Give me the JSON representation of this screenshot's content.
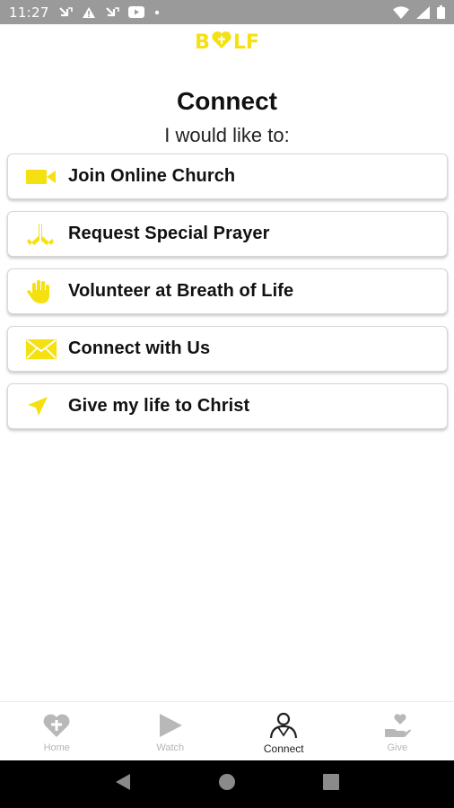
{
  "status_bar": {
    "time": "11:27",
    "left_icons": [
      "missed-call-icon",
      "warning-icon",
      "missed-call-icon",
      "youtube-icon",
      "dot-icon"
    ],
    "right_icons": [
      "wifi-icon",
      "signal-icon",
      "battery-icon"
    ]
  },
  "app": {
    "logo_left": "B",
    "logo_right": "LF",
    "accent_color": "#f5e112"
  },
  "header": {
    "title": "Connect",
    "subtitle": "I would like to:"
  },
  "actions": [
    {
      "label": "Join Online Church",
      "icon": "video-camera-icon"
    },
    {
      "label": "Request Special Prayer",
      "icon": "praying-hands-icon"
    },
    {
      "label": "Volunteer at Breath of Life",
      "icon": "raised-hand-icon"
    },
    {
      "label": "Connect with Us",
      "icon": "envelope-icon"
    },
    {
      "label": "Give my life to Christ",
      "icon": "navigation-arrow-icon"
    }
  ],
  "bottom_nav": {
    "items": [
      {
        "label": "Home",
        "icon": "heart-cross-icon",
        "active": false
      },
      {
        "label": "Watch",
        "icon": "play-icon",
        "active": false
      },
      {
        "label": "Connect",
        "icon": "person-icon",
        "active": true
      },
      {
        "label": "Give",
        "icon": "hand-heart-icon",
        "active": false
      }
    ]
  },
  "system_nav": [
    "back-icon",
    "home-circle-icon",
    "recents-icon"
  ]
}
